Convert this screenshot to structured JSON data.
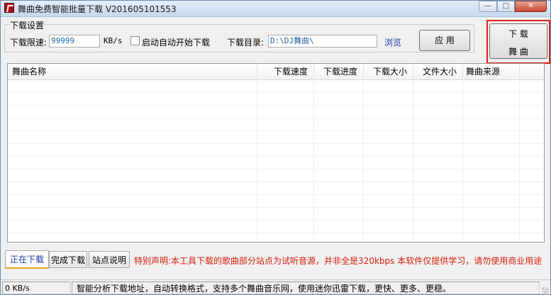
{
  "window": {
    "title": "舞曲免费智能批量下载 V201605101553",
    "min_glyph": "—",
    "max_glyph": "□",
    "close_glyph": "✕"
  },
  "settings": {
    "group_title": "下载设置",
    "speed_label": "下载限速:",
    "speed_value": "99999",
    "speed_unit": "KB/s",
    "auto_start_label": "启动自动开始下载",
    "auto_start_checked": false,
    "dir_label": "下载目录:",
    "dir_value": "D:\\DJ舞曲\\",
    "browse_label": "浏览",
    "apply_label": "应 用"
  },
  "download_button": {
    "line1": "下 载",
    "line2": "舞 曲"
  },
  "table": {
    "columns": [
      "舞曲名称",
      "下载速度",
      "下载进度",
      "下载大小",
      "文件大小",
      "舞曲来源"
    ],
    "rows": []
  },
  "tabs": [
    {
      "label": "正在下载",
      "active": true
    },
    {
      "label": "完成下载",
      "active": false
    },
    {
      "label": "站点说明",
      "active": false
    }
  ],
  "notice": "特别声明:本工具下载的歌曲部分站点为试听音源，并非全是320kbps 本软件仅提供学习，请勿使用商业用途",
  "statusbar": {
    "speed": "0 KB/s",
    "message": "智能分析下载地址，自动转换格式，支持多个舞曲音乐网，使用迷你迅雷下载，更快、更多、更稳。"
  },
  "colors": {
    "notice": "#d41e0e",
    "highlight_box": "#e0201a",
    "link": "#1f3fa8"
  }
}
